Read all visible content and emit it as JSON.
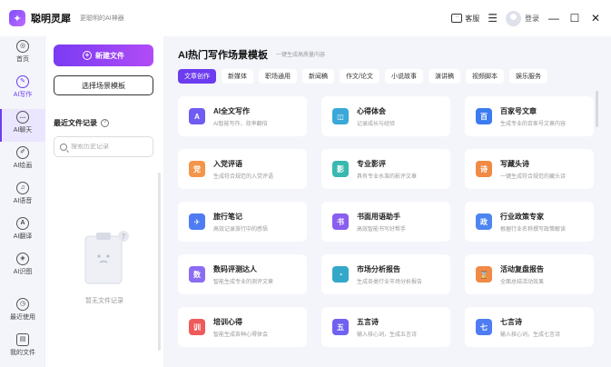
{
  "app": {
    "name": "聪明灵犀",
    "tagline": "更聪明的AI神器",
    "service_label": "客服",
    "login_label": "登录",
    "min_glyph": "—",
    "max_glyph": "☐",
    "close_glyph": "✕"
  },
  "rail": [
    {
      "label": "首页",
      "icon": "home-icon",
      "glyph": "◎"
    },
    {
      "label": "AI写作",
      "icon": "pen-icon",
      "glyph": "✎"
    },
    {
      "label": "AI聊天",
      "icon": "chat-icon",
      "glyph": "…"
    },
    {
      "label": "AI绘画",
      "icon": "brush-icon",
      "glyph": "✐"
    },
    {
      "label": "AI语音",
      "icon": "headphone-icon",
      "glyph": "♫"
    },
    {
      "label": "AI翻译",
      "icon": "translate-icon",
      "glyph": "A"
    },
    {
      "label": "AI识图",
      "icon": "scan-icon",
      "glyph": "◈"
    },
    {
      "label": "最近使用",
      "icon": "clock-icon",
      "glyph": "◷"
    },
    {
      "label": "我的文件",
      "icon": "file-icon",
      "glyph": "▤"
    }
  ],
  "panel": {
    "new_file_label": "新建文件",
    "choose_scene_label": "选择场景模板",
    "recent_title": "最近文件记录",
    "search_placeholder": "搜索历史记录",
    "empty_text": "暂无文件记录"
  },
  "main": {
    "title": "AI热门写作场景模板",
    "subtitle": "一键生成高质量内容",
    "tabs": [
      "文章创作",
      "新媒体",
      "职场通用",
      "新闻稿",
      "作文/论文",
      "小说故事",
      "演讲稿",
      "视频脚本",
      "娱乐服务"
    ],
    "cards": [
      {
        "title": "AI全文写作",
        "desc": "AI智能写作，效率翻倍",
        "color": "#6f5cf2",
        "glyph": "A"
      },
      {
        "title": "心得体会",
        "desc": "记录成长与经验",
        "color": "#3aa8d8",
        "glyph": "◫"
      },
      {
        "title": "百家号文章",
        "desc": "生成专业的百家号文章内容",
        "color": "#3b7cf0",
        "glyph": "百"
      },
      {
        "title": "入党评语",
        "desc": "生成符合规范的入党评语",
        "color": "#f3954a",
        "glyph": "党"
      },
      {
        "title": "专业影评",
        "desc": "具有专业水准的影评文章",
        "color": "#39b8b0",
        "glyph": "影"
      },
      {
        "title": "写藏头诗",
        "desc": "一键生成符合规范的藏头诗",
        "color": "#f08a45",
        "glyph": "诗"
      },
      {
        "title": "旅行笔记",
        "desc": "高效记录旅行中的感悟",
        "color": "#4f7cf2",
        "glyph": "✈"
      },
      {
        "title": "书面用语助手",
        "desc": "高效智能书写好帮手",
        "color": "#8a5ef0",
        "glyph": "书"
      },
      {
        "title": "行业政策专家",
        "desc": "根据行业名称撰写政策解读",
        "color": "#4d86f0",
        "glyph": "政"
      },
      {
        "title": "数码评测达人",
        "desc": "智能生成专业的测评文章",
        "color": "#8b6cf2",
        "glyph": "数"
      },
      {
        "title": "市场分析报告",
        "desc": "生成各类行业市场分析报告",
        "color": "#34a8c8",
        "glyph": "◔"
      },
      {
        "title": "活动复盘报告",
        "desc": "全面总结活动效果",
        "color": "#f08a45",
        "glyph": "⌛"
      },
      {
        "title": "培训心得",
        "desc": "智能生成各种心得体会",
        "color": "#ef5a5a",
        "glyph": "训"
      },
      {
        "title": "五言诗",
        "desc": "输入核心词，生成五言诗",
        "color": "#7062f0",
        "glyph": "五"
      },
      {
        "title": "七言诗",
        "desc": "输入核心词，生成七言诗",
        "color": "#4f7cf2",
        "glyph": "七"
      }
    ]
  }
}
